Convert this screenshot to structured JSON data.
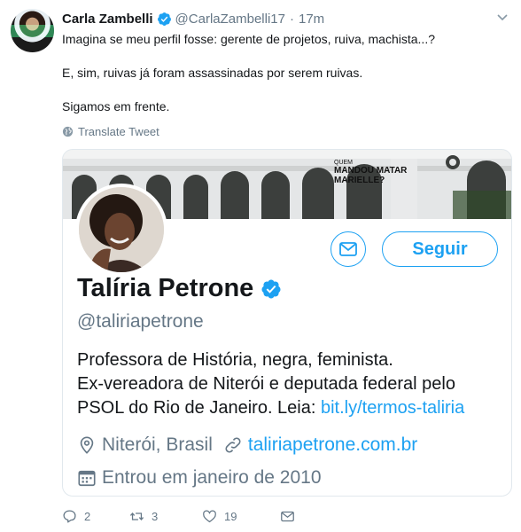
{
  "tweet": {
    "author_name": "Carla Zambelli",
    "author_handle": "@CarlaZambelli17",
    "separator": "·",
    "time": "17m",
    "paragraphs": [
      "Imagina se meu perfil fosse: gerente de projetos, ruiva, machista...?",
      "E, sim, ruivas já foram assassinadas por serem ruivas.",
      "Sigamos em frente."
    ],
    "translate_label": "Translate Tweet",
    "actions": {
      "replies": "2",
      "retweets": "3",
      "likes": "19"
    }
  },
  "card": {
    "banner_sign_text_1": "QUEM",
    "banner_sign_text_2": "MANDOU MATAR",
    "banner_sign_text_3": "MARIELLE?",
    "follow_label": "Seguir",
    "name": "Talíria Petrone",
    "handle": "@taliriapetrone",
    "bio_line1": "Professora de História, negra, feminista.",
    "bio_line2": "Ex-vereadora de Niterói e deputada federal pelo",
    "bio_line3_prefix": "PSOL do Rio de Janeiro. Leia: ",
    "bio_link": "bit.ly/termos-taliria",
    "location": "Niterói, Brasil",
    "website": "taliriapetrone.com.br",
    "joined": "Entrou em janeiro de 2010"
  },
  "colors": {
    "accent": "#1da1f2",
    "muted": "#657786",
    "text": "#14171a",
    "border": "#e1e8ed"
  },
  "icons": [
    "verified-badge-icon",
    "caret-down-icon",
    "globe-icon",
    "envelope-icon",
    "location-pin-icon",
    "link-icon",
    "calendar-icon",
    "reply-icon",
    "retweet-icon",
    "heart-icon",
    "dm-icon"
  ]
}
